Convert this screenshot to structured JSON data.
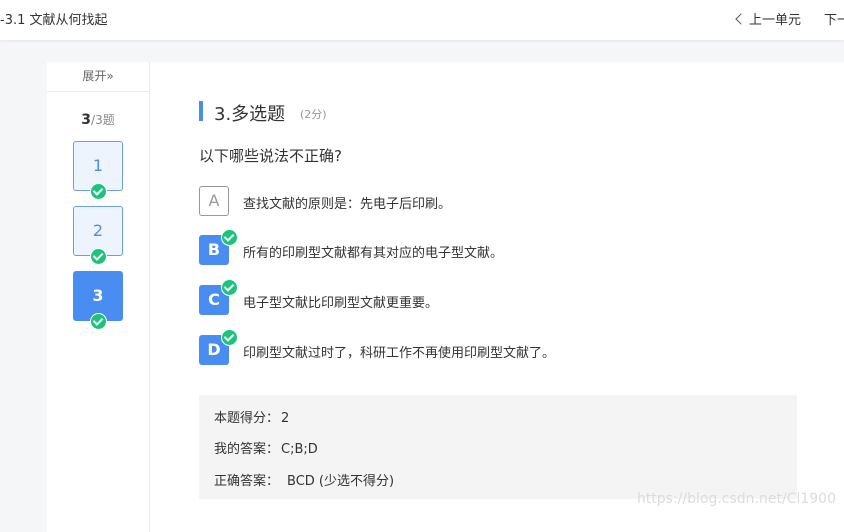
{
  "topbar": {
    "title": "-3.1 文献从何找起",
    "prev_unit": "上一单元",
    "next_unit": "下一"
  },
  "sidebar": {
    "expand_label": "展开»",
    "counter_current": "3",
    "counter_total": "/3题",
    "questions": [
      {
        "label": "1",
        "state": "answered"
      },
      {
        "label": "2",
        "state": "answered"
      },
      {
        "label": "3",
        "state": "current"
      }
    ]
  },
  "question": {
    "title": "3.多选题",
    "score": "(2分)",
    "stem": "以下哪些说法不正确?",
    "options": [
      {
        "letter": "A",
        "text": "查找文献的原则是：先电子后印刷。",
        "selected": false
      },
      {
        "letter": "B",
        "text": "所有的印刷型文献都有其对应的电子型文献。",
        "selected": true
      },
      {
        "letter": "C",
        "text": "电子型文献比印刷型文献更重要。",
        "selected": true
      },
      {
        "letter": "D",
        "text": "印刷型文献过时了，科研工作不再使用印刷型文献了。",
        "selected": true
      }
    ]
  },
  "result": {
    "score_label": "本题得分：",
    "score_value": "2",
    "my_answer_label": "我的答案：",
    "my_answer_value": "C;B;D",
    "correct_label": "正确答案：",
    "correct_value": "BCD (少选不得分)"
  },
  "watermark": "https://blog.csdn.net/Cl1900",
  "colors": {
    "accent": "#4a8df0",
    "check": "#1bc47d",
    "answer_bg": "#f4f4f4"
  }
}
